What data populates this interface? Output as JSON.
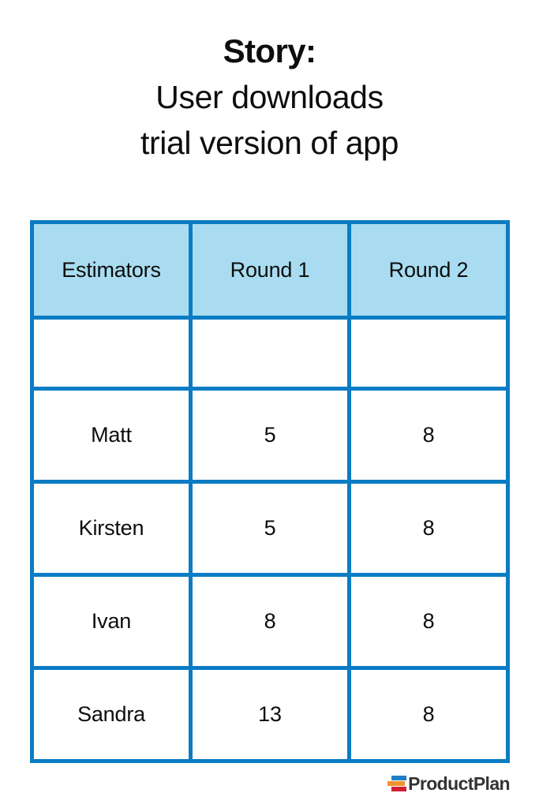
{
  "page": {
    "background_color": "#ffffff"
  },
  "title": {
    "line1": "Story:",
    "line2": "User downloads",
    "line3": "trial version of app"
  },
  "table": {
    "border_color": "#0b7cc4",
    "header_fill_color": "#a9dcf1",
    "headers": [
      "Estimators",
      "Round 1",
      "Round 2"
    ],
    "spacer_row": [
      "",
      "",
      ""
    ],
    "rows": [
      {
        "estimator": "Matt",
        "round1": "5",
        "round2": "8"
      },
      {
        "estimator": "Kirsten",
        "round1": "5",
        "round2": "8"
      },
      {
        "estimator": "Ivan",
        "round1": "8",
        "round2": "8"
      },
      {
        "estimator": "Sandra",
        "round1": "13",
        "round2": "8"
      }
    ]
  },
  "logo": {
    "text": "ProductPlan",
    "mark_colors": {
      "top": "#1f7dc4",
      "middle": "#f0922d",
      "bottom": "#d12033"
    },
    "text_color": "#333333"
  }
}
